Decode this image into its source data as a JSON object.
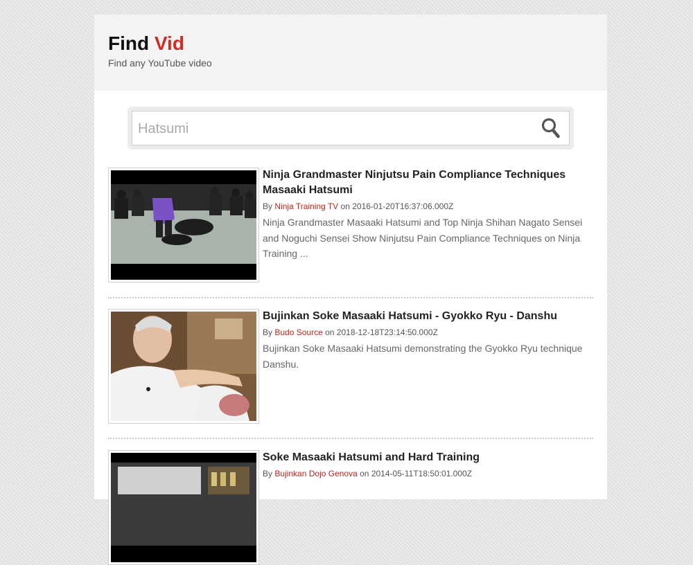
{
  "header": {
    "brand_main": "Find",
    "brand_accent": "Vid",
    "tagline": "Find any YouTube video"
  },
  "search": {
    "placeholder": "Hatsumi",
    "value": ""
  },
  "colors": {
    "accent": "#d42a22",
    "channel_link": "#c0241c",
    "header_bg": "#f3f3f3"
  },
  "results": [
    {
      "title": "Ninja Grandmaster Ninjutsu Pain Compliance Techniques Masaaki Hatsumi",
      "by_label": "By",
      "channel": "Ninja Training TV",
      "on_label": "on",
      "date": "2016-01-20T16:37:06.000Z",
      "description": "Ninja Grandmaster Masaaki Hatsumi and Top Ninja Shihan Nagato Sensei and Noguchi Sensei Show Ninjutsu Pain Compliance Techniques on Ninja Training ..."
    },
    {
      "title": "Bujinkan Soke Masaaki Hatsumi - Gyokko Ryu - Danshu",
      "by_label": "By",
      "channel": "Budo Source",
      "on_label": "on",
      "date": "2018-12-18T23:14:50.000Z",
      "description": "Bujinkan Soke Masaaki Hatsumi demonstrating the Gyokko Ryu technique Danshu."
    },
    {
      "title": "Soke Masaaki Hatsumi and Hard Training",
      "by_label": "By",
      "channel": "Bujinkan Dojo Genova",
      "on_label": "on",
      "date": "2014-05-11T18:50:01.000Z",
      "description": ""
    }
  ]
}
